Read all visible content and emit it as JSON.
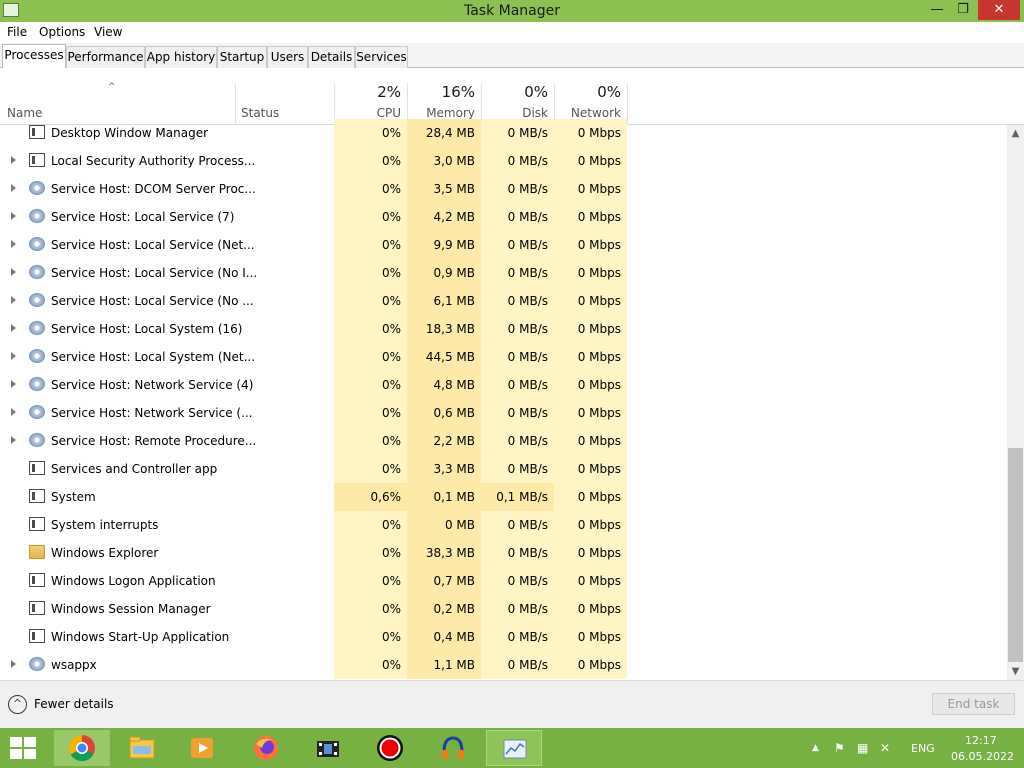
{
  "window": {
    "title": "Task Manager",
    "minimize": "—",
    "maximize": "❐",
    "close": "✕"
  },
  "menu": [
    "File",
    "Options",
    "View"
  ],
  "tabs": [
    "Processes",
    "Performance",
    "App history",
    "Startup",
    "Users",
    "Details",
    "Services"
  ],
  "columns": {
    "sort_indicator": "^",
    "name": "Name",
    "status": "Status",
    "cpu": {
      "pct": "2%",
      "label": "CPU"
    },
    "memory": {
      "pct": "16%",
      "label": "Memory"
    },
    "disk": {
      "pct": "0%",
      "label": "Disk"
    },
    "network": {
      "pct": "0%",
      "label": "Network"
    }
  },
  "processes": [
    {
      "name": "Desktop Window Manager",
      "icon": "app-icon",
      "expandable": false,
      "cpu": "0%",
      "memory": "28,4 MB",
      "disk": "0 MB/s",
      "network": "0 Mbps"
    },
    {
      "name": "Local Security Authority Process...",
      "icon": "app-icon",
      "expandable": true,
      "cpu": "0%",
      "memory": "3,0 MB",
      "disk": "0 MB/s",
      "network": "0 Mbps"
    },
    {
      "name": "Service Host: DCOM Server Proc...",
      "icon": "gear-icon",
      "expandable": true,
      "cpu": "0%",
      "memory": "3,5 MB",
      "disk": "0 MB/s",
      "network": "0 Mbps"
    },
    {
      "name": "Service Host: Local Service (7)",
      "icon": "gear-icon",
      "expandable": true,
      "cpu": "0%",
      "memory": "4,2 MB",
      "disk": "0 MB/s",
      "network": "0 Mbps"
    },
    {
      "name": "Service Host: Local Service (Net...",
      "icon": "gear-icon",
      "expandable": true,
      "cpu": "0%",
      "memory": "9,9 MB",
      "disk": "0 MB/s",
      "network": "0 Mbps"
    },
    {
      "name": "Service Host: Local Service (No I...",
      "icon": "gear-icon",
      "expandable": true,
      "cpu": "0%",
      "memory": "0,9 MB",
      "disk": "0 MB/s",
      "network": "0 Mbps"
    },
    {
      "name": "Service Host: Local Service (No ...",
      "icon": "gear-icon",
      "expandable": true,
      "cpu": "0%",
      "memory": "6,1 MB",
      "disk": "0 MB/s",
      "network": "0 Mbps"
    },
    {
      "name": "Service Host: Local System (16)",
      "icon": "gear-icon",
      "expandable": true,
      "cpu": "0%",
      "memory": "18,3 MB",
      "disk": "0 MB/s",
      "network": "0 Mbps"
    },
    {
      "name": "Service Host: Local System (Net...",
      "icon": "gear-icon",
      "expandable": true,
      "cpu": "0%",
      "memory": "44,5 MB",
      "disk": "0 MB/s",
      "network": "0 Mbps"
    },
    {
      "name": "Service Host: Network Service (4)",
      "icon": "gear-icon",
      "expandable": true,
      "cpu": "0%",
      "memory": "4,8 MB",
      "disk": "0 MB/s",
      "network": "0 Mbps"
    },
    {
      "name": "Service Host: Network Service (...",
      "icon": "gear-icon",
      "expandable": true,
      "cpu": "0%",
      "memory": "0,6 MB",
      "disk": "0 MB/s",
      "network": "0 Mbps"
    },
    {
      "name": "Service Host: Remote Procedure...",
      "icon": "gear-icon",
      "expandable": true,
      "cpu": "0%",
      "memory": "2,2 MB",
      "disk": "0 MB/s",
      "network": "0 Mbps"
    },
    {
      "name": "Services and Controller app",
      "icon": "app-icon",
      "expandable": false,
      "cpu": "0%",
      "memory": "3,3 MB",
      "disk": "0 MB/s",
      "network": "0 Mbps"
    },
    {
      "name": "System",
      "icon": "app-icon",
      "expandable": false,
      "cpu": "0,6%",
      "memory": "0,1 MB",
      "disk": "0,1 MB/s",
      "network": "0 Mbps",
      "hot": true
    },
    {
      "name": "System interrupts",
      "icon": "app-icon",
      "expandable": false,
      "cpu": "0%",
      "memory": "0 MB",
      "disk": "0 MB/s",
      "network": "0 Mbps"
    },
    {
      "name": "Windows Explorer",
      "icon": "folder-icon",
      "expandable": false,
      "cpu": "0%",
      "memory": "38,3 MB",
      "disk": "0 MB/s",
      "network": "0 Mbps"
    },
    {
      "name": "Windows Logon Application",
      "icon": "app-icon",
      "expandable": false,
      "cpu": "0%",
      "memory": "0,7 MB",
      "disk": "0 MB/s",
      "network": "0 Mbps"
    },
    {
      "name": "Windows Session Manager",
      "icon": "app-icon",
      "expandable": false,
      "cpu": "0%",
      "memory": "0,2 MB",
      "disk": "0 MB/s",
      "network": "0 Mbps"
    },
    {
      "name": "Windows Start-Up Application",
      "icon": "app-icon",
      "expandable": false,
      "cpu": "0%",
      "memory": "0,4 MB",
      "disk": "0 MB/s",
      "network": "0 Mbps"
    },
    {
      "name": "wsappx",
      "icon": "gear-icon",
      "expandable": true,
      "cpu": "0%",
      "memory": "1,1 MB",
      "disk": "0 MB/s",
      "network": "0 Mbps"
    }
  ],
  "footer": {
    "fewer_details": "Fewer details",
    "fewer_icon": "^",
    "end_task": "End task"
  },
  "taskbar": {
    "apps": [
      "chrome-icon",
      "file-explorer-icon",
      "media-player-icon",
      "firefox-icon",
      "video-editor-icon",
      "record-icon",
      "audio-editor-icon",
      "task-manager-icon"
    ],
    "tray": {
      "chevron": "▲",
      "language": "ENG",
      "time": "12:17",
      "date": "06.05.2022"
    }
  },
  "colors": {
    "titlebar": "#8cc152",
    "taskbar": "#77b043",
    "close": "#c7372f",
    "heat_low": "#fff4c4",
    "heat_mid": "#fde9a8"
  }
}
